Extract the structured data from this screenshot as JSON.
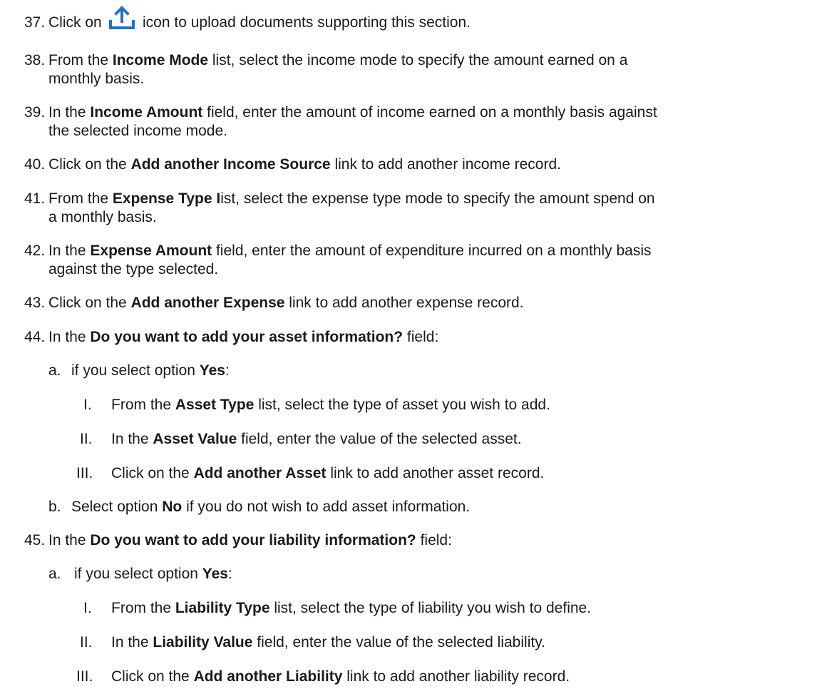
{
  "steps": {
    "s37": {
      "num": "37.",
      "pre": "Click on",
      "post": "icon to upload documents supporting this section."
    },
    "s38": {
      "num": "38.",
      "pre": "From the ",
      "bold": "Income Mode",
      "post": " list, select the income mode to specify the amount earned on a",
      "cont": "monthly basis."
    },
    "s39": {
      "num": "39.",
      "pre": "In the ",
      "bold": "Income Amount",
      "post": " field, enter the amount of income earned on a monthly basis against",
      "cont": "the selected income mode."
    },
    "s40": {
      "num": "40.",
      "pre": "Click on the ",
      "bold": "Add another Income Source",
      "post": " link to add another income record."
    },
    "s41": {
      "num": "41.",
      "pre": "From the ",
      "bold": "Expense Type I",
      "post": "ist, select the expense type mode to specify the amount spend on",
      "cont": "a monthly basis."
    },
    "s42": {
      "num": "42.",
      "pre": "In the ",
      "bold": "Expense Amount",
      "post": " field, enter the amount of expenditure incurred on a monthly basis",
      "cont": "against the type selected."
    },
    "s43": {
      "num": "43.",
      "pre": "Click on the ",
      "bold": "Add another Expense",
      "post": " link to add another expense record."
    },
    "s44": {
      "num": "44.",
      "pre": "In the ",
      "bold": "Do you want to add your asset information?",
      "post": " field:",
      "a": {
        "label": "a.",
        "pre": "if you select option ",
        "bold": "Yes",
        "post": ":"
      },
      "i1": {
        "label": "I.",
        "pre": "From the ",
        "bold": "Asset Type",
        "post": " list, select the type of asset you wish to add."
      },
      "i2": {
        "label": "II.",
        "pre": "In the ",
        "bold": "Asset Value",
        "post": " field, enter the value of the selected asset."
      },
      "i3": {
        "label": "III.",
        "pre": "Click on the ",
        "bold": "Add another Asset",
        "post": " link to add another asset record."
      },
      "b": {
        "label": "b.",
        "pre": "Select option ",
        "bold": "No",
        "post": " if you do not wish to add asset information."
      }
    },
    "s45": {
      "num": "45.",
      "pre": "In the ",
      "bold": "Do you want to add your liability information?",
      "post": " field:",
      "a": {
        "label": "a.",
        "pre": "if you select option ",
        "bold": "Yes",
        "post": ":"
      },
      "i1": {
        "label": "I.",
        "pre": "From the ",
        "bold": "Liability Type",
        "post": " list, select the type of liability you wish to define."
      },
      "i2": {
        "label": "II.",
        "pre": "In the ",
        "bold": "Liability Value",
        "post": " field, enter the value of the selected liability."
      },
      "i3": {
        "label": "III.",
        "pre": "Click on the ",
        "bold": "Add another Liability",
        "post": " link to add another liability record."
      }
    }
  },
  "colors": {
    "text": "#1a1a1a",
    "icon": "#1e73c8"
  },
  "icons": {
    "upload": "upload-icon"
  }
}
